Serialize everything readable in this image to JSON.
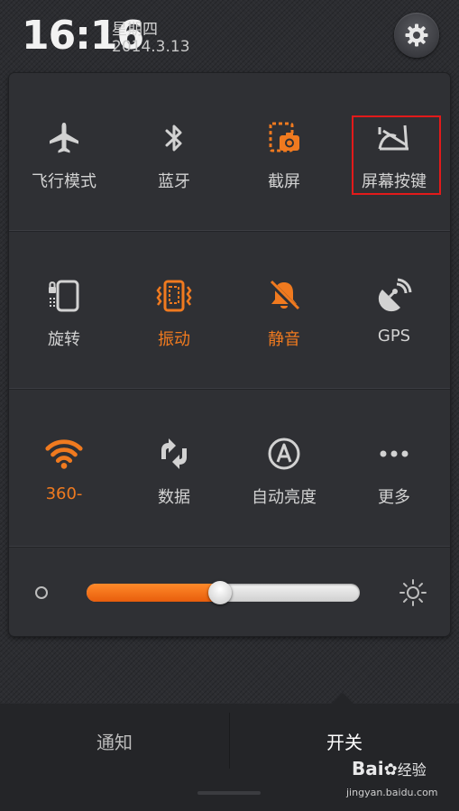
{
  "status": {
    "time": "16:16",
    "weekday": "星期四",
    "date": "2014.3.13"
  },
  "colors": {
    "accent": "#f07a1f",
    "inactive": "#d2d2d2",
    "highlight": "#e21a1a"
  },
  "toggles": {
    "row1": [
      {
        "label": "飞行模式",
        "icon": "airplane-icon",
        "on": false
      },
      {
        "label": "蓝牙",
        "icon": "bluetooth-icon",
        "on": false
      },
      {
        "label": "截屏",
        "icon": "screenshot-icon",
        "on": false
      },
      {
        "label": "屏幕按键",
        "icon": "screen-buttons-icon",
        "on": false
      }
    ],
    "row2": [
      {
        "label": "旋转",
        "icon": "rotate-icon",
        "on": false
      },
      {
        "label": "振动",
        "icon": "vibrate-icon",
        "on": true
      },
      {
        "label": "静音",
        "icon": "mute-icon",
        "on": true
      },
      {
        "label": "GPS",
        "icon": "gps-icon",
        "on": false
      }
    ],
    "row3": [
      {
        "label": "360-",
        "icon": "wifi-icon",
        "on": true
      },
      {
        "label": "数据",
        "icon": "data-icon",
        "on": false
      },
      {
        "label": "自动亮度",
        "icon": "auto-brightness-icon",
        "on": false
      },
      {
        "label": "更多",
        "icon": "more-icon",
        "on": false
      }
    ]
  },
  "brightness": {
    "level": 0.49
  },
  "tabs": {
    "notify": "通知",
    "switch": "开关",
    "active": "switch"
  },
  "watermark": {
    "logo": "Bai",
    "logo_suffix": "经验",
    "url": "jingyan.baidu.com"
  }
}
